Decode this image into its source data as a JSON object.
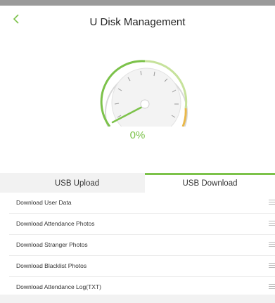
{
  "header": {
    "title": "U Disk Management",
    "back_icon": "chevron-left-icon"
  },
  "gauge": {
    "progress_percent": 0,
    "progress_label": "0%"
  },
  "tabs": [
    {
      "label": "USB Upload",
      "selected": false
    },
    {
      "label": "USB Download",
      "selected": true
    }
  ],
  "list": {
    "items": [
      {
        "label": "Download User Data"
      },
      {
        "label": "Download Attendance Photos"
      },
      {
        "label": "Download Stranger Photos"
      },
      {
        "label": "Download Blacklist Photos"
      },
      {
        "label": "Download Attendance Log(TXT)"
      }
    ]
  },
  "colors": {
    "accent": "#7cc24a",
    "gauge_warning": "#e9b84a"
  }
}
